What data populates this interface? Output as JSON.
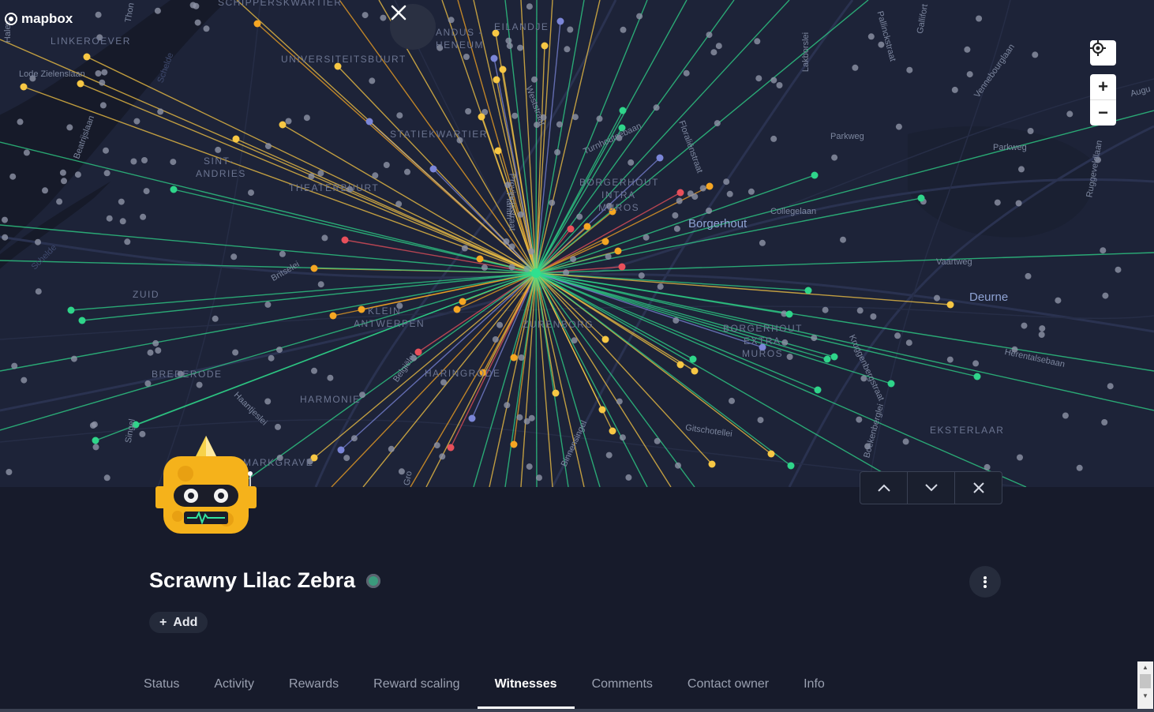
{
  "map": {
    "attribution_logo": "mapbox",
    "close_icon": "close-icon",
    "hub_color": "#2fe08f",
    "witness_colors": {
      "green": "#2fd58a",
      "orange": "#f5a623",
      "yellow": "#f7c744",
      "red": "#e8505b",
      "blue": "#7b86d8"
    },
    "labels": [
      "SCHIPPERSKWARTIER",
      "LINKEROEVER",
      "Lode Zielenslaan",
      "UNIVERSITEITSBUURT",
      "ANDUS -",
      "HENEUM",
      "EILANDJE",
      "STATIEKWARTIER",
      "SINT-",
      "ANDRIES",
      "THEATERBUURT",
      "BORGERHOUT",
      "INTRA",
      "MUROS",
      "Borgerhout",
      "Collegelaan",
      "Parkweg",
      "Parkweg",
      "Vaartweg",
      "Deurne",
      "ZUID",
      "KLEIN",
      "ANTWERPEN",
      "ZURENBORG",
      "BORGERHOUT",
      "EXTRA",
      "MUROS",
      "Herentalsebaan",
      "BREDERODE",
      "HARINGRODE",
      "HARMONIE",
      "MARKGRAVE",
      "Gitschotellei",
      "EKSTERLAAR",
      "Beatrijslaan",
      "Britselei",
      "Belgiëlei",
      "Singel",
      "Haantjeslei",
      "Plantin",
      "Schelde",
      "Schelde",
      "Turnhoutsebaan",
      "Provinciestraat",
      "Floraliënstraat",
      "Lakborslei",
      "Pallinckstraat",
      "Gallifort",
      "Vennebourglaan",
      "Ruggeveldlaan",
      "Binnensingel",
      "Kruggenbergstraat",
      "Boekenberglei",
      "Thon",
      "Halev",
      "Augu",
      "Weststraat",
      "Gro"
    ]
  },
  "controls": {
    "locate_icon": "locate-icon",
    "zoom_in": "+",
    "zoom_out": "−"
  },
  "nav": {
    "up_icon": "chevron-up-icon",
    "down_icon": "chevron-down-icon",
    "close_icon": "close-icon"
  },
  "hotspot": {
    "name": "Scrawny Lilac Zebra",
    "status_color": "#3a9a7c",
    "add_label": "Add",
    "add_icon": "+"
  },
  "tabs": [
    "Status",
    "Activity",
    "Rewards",
    "Reward scaling",
    "Witnesses",
    "Comments",
    "Contact owner",
    "Info"
  ],
  "active_tab": "Witnesses"
}
